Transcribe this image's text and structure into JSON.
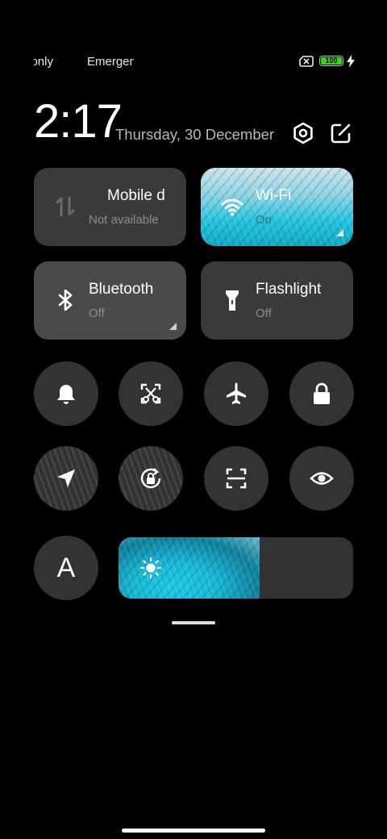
{
  "status_bar": {
    "carrier_1": "only",
    "carrier_2": "Emergen",
    "battery_level": "100",
    "sim_icon": "no-sim-icon",
    "charging_icon": "bolt-icon"
  },
  "header": {
    "time": "2:17",
    "date": "Thursday, 30 December",
    "settings_icon": "settings-icon",
    "edit_icon": "edit-icon"
  },
  "tiles": {
    "mobile_data": {
      "label": "Mobile d",
      "sub": "Not available",
      "active": false
    },
    "wifi": {
      "label": "Wi-Fi",
      "sub": "On",
      "active": true
    },
    "bluetooth": {
      "label": "Bluetooth",
      "sub": "Off",
      "active": false
    },
    "flashlight": {
      "label": "Flashlight",
      "sub": "Off",
      "active": false
    }
  },
  "toggles_row1": [
    {
      "name": "bell-icon",
      "active": false
    },
    {
      "name": "screenshot-icon",
      "active": false
    },
    {
      "name": "airplane-icon",
      "active": false
    },
    {
      "name": "lock-icon",
      "active": false
    }
  ],
  "toggles_row2": [
    {
      "name": "location-icon",
      "active": true
    },
    {
      "name": "rotation-lock-icon",
      "active": true
    },
    {
      "name": "scan-icon",
      "active": false
    },
    {
      "name": "eye-icon",
      "active": false
    }
  ],
  "auto_brightness_label": "A",
  "brightness": {
    "level": 0.6
  }
}
